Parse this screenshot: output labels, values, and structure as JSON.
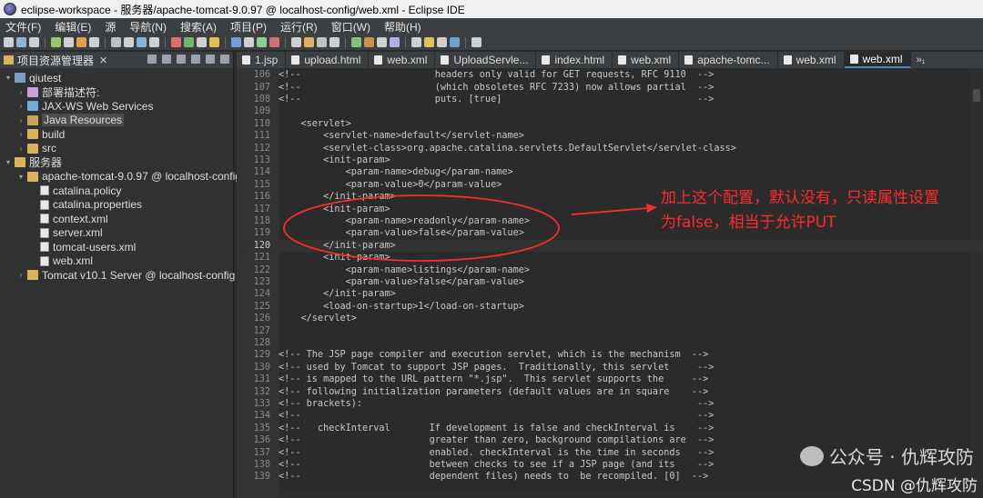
{
  "window": {
    "title": "eclipse-workspace - 服务器/apache-tomcat-9.0.97 @ localhost-config/web.xml - Eclipse IDE"
  },
  "menu": [
    "文件(F)",
    "编辑(E)",
    "源",
    "导航(N)",
    "搜索(A)",
    "项目(P)",
    "运行(R)",
    "窗口(W)",
    "帮助(H)"
  ],
  "explorer": {
    "title": "项目资源管理器",
    "close": "✕",
    "items": [
      {
        "label": "qiutest",
        "indent": 0,
        "arrow": "▾",
        "icon": "proj"
      },
      {
        "label": "部署描述符:",
        "indent": 1,
        "arrow": "›",
        "icon": "desc"
      },
      {
        "label": "JAX-WS Web Services",
        "indent": 1,
        "arrow": "›",
        "icon": "ws"
      },
      {
        "label": "Java Resources",
        "indent": 1,
        "arrow": "›",
        "icon": "jr",
        "selected": true
      },
      {
        "label": "build",
        "indent": 1,
        "arrow": "›",
        "icon": "folder"
      },
      {
        "label": "src",
        "indent": 1,
        "arrow": "›",
        "icon": "folder"
      },
      {
        "label": "服务器",
        "indent": 0,
        "arrow": "▾",
        "icon": "folder"
      },
      {
        "label": "apache-tomcat-9.0.97 @ localhost-config",
        "indent": 1,
        "arrow": "▾",
        "icon": "folder"
      },
      {
        "label": "catalina.policy",
        "indent": 2,
        "arrow": "",
        "icon": "file"
      },
      {
        "label": "catalina.properties",
        "indent": 2,
        "arrow": "",
        "icon": "file"
      },
      {
        "label": "context.xml",
        "indent": 2,
        "arrow": "",
        "icon": "file"
      },
      {
        "label": "server.xml",
        "indent": 2,
        "arrow": "",
        "icon": "file"
      },
      {
        "label": "tomcat-users.xml",
        "indent": 2,
        "arrow": "",
        "icon": "file"
      },
      {
        "label": "web.xml",
        "indent": 2,
        "arrow": "",
        "icon": "file"
      },
      {
        "label": "Tomcat v10.1 Server @ localhost-config",
        "indent": 1,
        "arrow": "›",
        "icon": "folder"
      }
    ]
  },
  "tabs": [
    {
      "label": "1.jsp",
      "active": false
    },
    {
      "label": "upload.html",
      "active": false
    },
    {
      "label": "web.xml",
      "active": false
    },
    {
      "label": "UploadServle...",
      "active": false
    },
    {
      "label": "index.html",
      "active": false
    },
    {
      "label": "web.xml",
      "active": false
    },
    {
      "label": "apache-tomc...",
      "active": false
    },
    {
      "label": "web.xml",
      "active": false
    },
    {
      "label": "web.xml",
      "active": true
    }
  ],
  "tabs_more": "»₁",
  "code": {
    "current_line": 120,
    "lines": [
      {
        "n": "106",
        "t": "<!--                        headers only valid for GET requests, RFC 9110  -->"
      },
      {
        "n": "107",
        "t": "<!--                        (which obsoletes RFC 7233) now allows partial  -->"
      },
      {
        "n": "108",
        "t": "<!--                        puts. [true]                                   -->"
      },
      {
        "n": "109",
        "t": ""
      },
      {
        "n": "110",
        "t": "    <servlet>"
      },
      {
        "n": "111",
        "t": "        <servlet-name>default</servlet-name>"
      },
      {
        "n": "112",
        "t": "        <servlet-class>org.apache.catalina.servlets.DefaultServlet</servlet-class>"
      },
      {
        "n": "113",
        "t": "        <init-param>"
      },
      {
        "n": "114",
        "t": "            <param-name>debug</param-name>"
      },
      {
        "n": "115",
        "t": "            <param-value>0</param-value>"
      },
      {
        "n": "116",
        "t": "        </init-param>"
      },
      {
        "n": "117",
        "t": "        <init-param>"
      },
      {
        "n": "118",
        "t": "            <param-name>readonly</param-name>"
      },
      {
        "n": "119",
        "t": "            <param-value>false</param-value>"
      },
      {
        "n": "120",
        "t": "        </init-param>"
      },
      {
        "n": "121",
        "t": "        <init-param>"
      },
      {
        "n": "122",
        "t": "            <param-name>listings</param-name>"
      },
      {
        "n": "123",
        "t": "            <param-value>false</param-value>"
      },
      {
        "n": "124",
        "t": "        </init-param>"
      },
      {
        "n": "125",
        "t": "        <load-on-startup>1</load-on-startup>"
      },
      {
        "n": "126",
        "t": "    </servlet>"
      },
      {
        "n": "127",
        "t": ""
      },
      {
        "n": "128",
        "t": ""
      },
      {
        "n": "129",
        "t": "<!-- The JSP page compiler and execution servlet, which is the mechanism  -->"
      },
      {
        "n": "130",
        "t": "<!-- used by Tomcat to support JSP pages.  Traditionally, this servlet     -->"
      },
      {
        "n": "131",
        "t": "<!-- is mapped to the URL pattern \"*.jsp\".  This servlet supports the     -->"
      },
      {
        "n": "132",
        "t": "<!-- following initialization parameters (default values are in square    -->"
      },
      {
        "n": "133",
        "t": "<!-- brackets):                                                            -->"
      },
      {
        "n": "134",
        "t": "<!--                                                                       -->"
      },
      {
        "n": "135",
        "t": "<!--   checkInterval       If development is false and checkInterval is    -->"
      },
      {
        "n": "136",
        "t": "<!--                       greater than zero, background compilations are  -->"
      },
      {
        "n": "137",
        "t": "<!--                       enabled. checkInterval is the time in seconds   -->"
      },
      {
        "n": "138",
        "t": "<!--                       between checks to see if a JSP page (and its    -->"
      },
      {
        "n": "139",
        "t": "<!--                       dependent files) needs to  be recompiled. [0]  -->"
      }
    ]
  },
  "annotation": {
    "text_line1": "加上这个配置，默认没有，只读属性设置",
    "text_line2": "为false，相当于允许PUT",
    "color": "#ff2a2a"
  },
  "watermark": {
    "text": "公众号 · 仇辉攻防"
  },
  "credit": {
    "text": "CSDN @仇辉攻防"
  }
}
